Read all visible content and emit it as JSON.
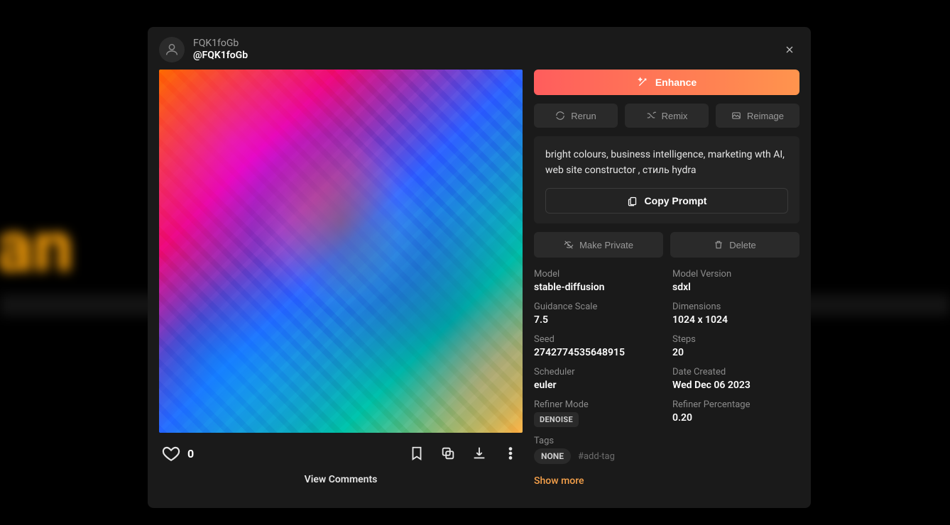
{
  "user": {
    "display_name": "FQK1foGb",
    "handle": "@FQK1foGb"
  },
  "likes": "0",
  "view_comments": "View Comments",
  "actions": {
    "enhance": "Enhance",
    "rerun": "Rerun",
    "remix": "Remix",
    "reimage": "Reimage",
    "copy_prompt": "Copy Prompt",
    "make_private": "Make Private",
    "delete": "Delete"
  },
  "prompt": "bright colours, business intelligence, marketing wth AI, web site constructor , стиль hydra",
  "meta": {
    "model_label": "Model",
    "model": "stable-diffusion",
    "model_version_label": "Model Version",
    "model_version": "sdxl",
    "guidance_label": "Guidance Scale",
    "guidance": "7.5",
    "dimensions_label": "Dimensions",
    "dimensions": "1024 x 1024",
    "seed_label": "Seed",
    "seed": "2742774535648915",
    "steps_label": "Steps",
    "steps": "20",
    "scheduler_label": "Scheduler",
    "scheduler": "euler",
    "date_label": "Date Created",
    "date": "Wed Dec 06 2023",
    "refiner_mode_label": "Refiner Mode",
    "refiner_mode": "DENOISE",
    "refiner_pct_label": "Refiner Percentage",
    "refiner_pct": "0.20",
    "tags_label": "Tags"
  },
  "tags": {
    "none": "NONE",
    "add": "#add-tag"
  },
  "show_more": "Show more"
}
